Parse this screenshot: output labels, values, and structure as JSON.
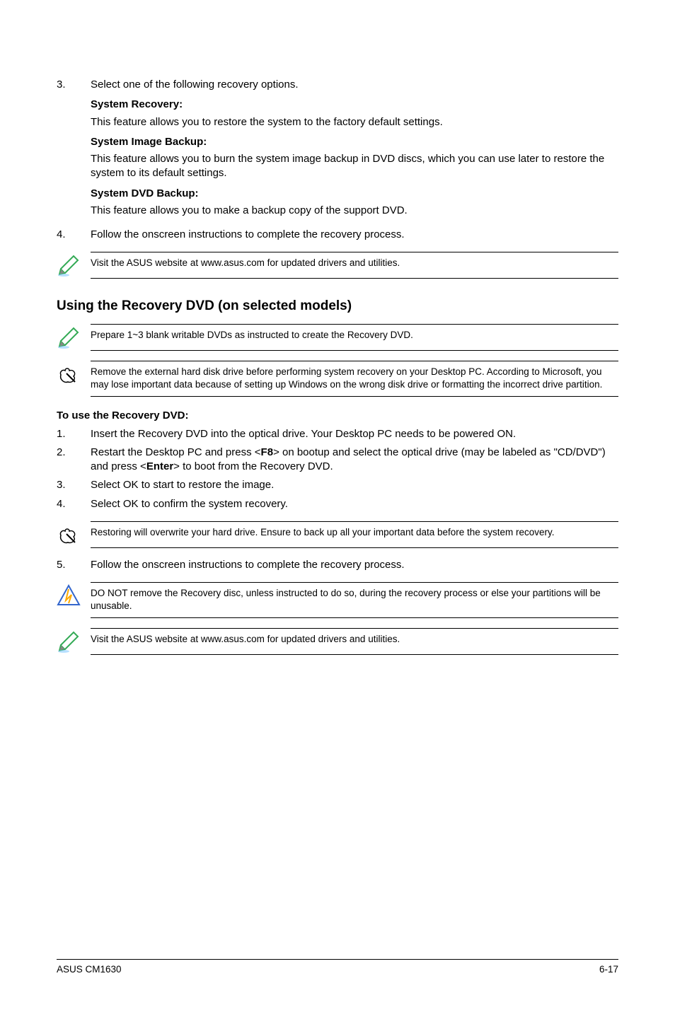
{
  "top_list": {
    "item3": {
      "num": "3.",
      "intro": "Select one of the following recovery options.",
      "blocks": [
        {
          "title": "System Recovery:",
          "desc": "This feature allows you to restore the system to the factory default settings."
        },
        {
          "title": "System Image Backup:",
          "desc": "This feature allows you to burn the system image backup in DVD discs, which you can use later to restore the system to its default settings."
        },
        {
          "title": "System DVD Backup:",
          "desc": "This feature allows you to make a backup copy of the support DVD."
        }
      ]
    },
    "item4": {
      "num": "4.",
      "text": "Follow the onscreen instructions to complete the recovery process."
    }
  },
  "note_visit1": "Visit the ASUS website at www.asus.com for updated drivers and utilities.",
  "section_heading": "Using the Recovery DVD (on selected models)",
  "note_prepare": "Prepare 1~3 blank writable DVDs as instructed to create the Recovery DVD.",
  "note_remove": "Remove the external hard disk drive before performing system recovery on your Desktop PC. According to Microsoft, you may lose important data because of setting up Windows on the wrong disk drive or formatting the incorrect drive partition.",
  "subheading": "To use the Recovery DVD:",
  "steps": [
    {
      "num": "1.",
      "text": "Insert the Recovery DVD into the optical drive. Your Desktop PC needs to be powered ON."
    },
    {
      "num": "2.",
      "prefix": "Restart the Desktop PC and press <",
      "key1": "F8",
      "mid": "> on bootup and select the optical drive (may be labeled as \"CD/DVD\") and press <",
      "key2": "Enter",
      "suffix": "> to boot from the Recovery DVD."
    },
    {
      "num": "3.",
      "text": "Select OK to start to restore the image."
    },
    {
      "num": "4.",
      "text": "Select OK to confirm the system recovery."
    }
  ],
  "note_restoring": "Restoring will overwrite your hard drive. Ensure to back up all your important data before the system recovery.",
  "step5": {
    "num": "5.",
    "text": "Follow the onscreen instructions to complete the recovery process."
  },
  "note_donot": "DO NOT remove the Recovery disc, unless instructed to do so, during the recovery process or else your partitions will be unusable.",
  "note_visit2": "Visit the ASUS website at www.asus.com for updated drivers and utilities.",
  "footer": {
    "left": "ASUS CM1630",
    "right": "6-17"
  }
}
